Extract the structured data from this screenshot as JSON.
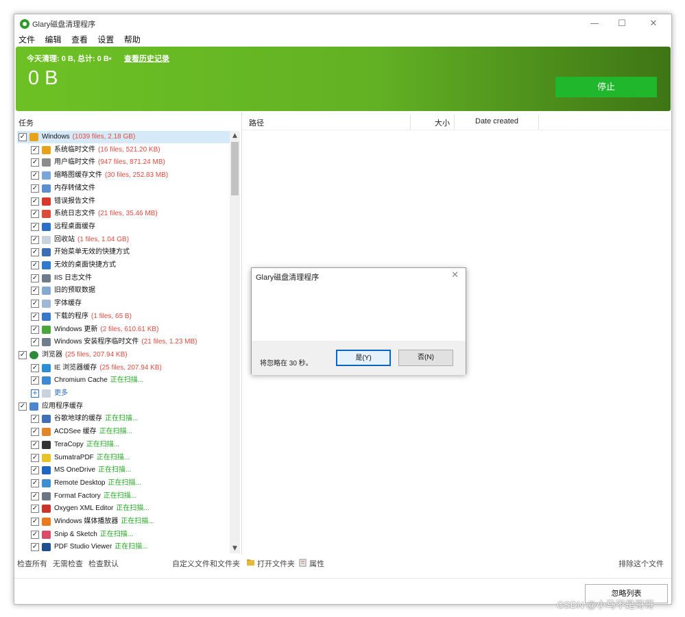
{
  "window": {
    "title": "Glary磁盘清理程序",
    "controls": {
      "minimize": "—",
      "maximize": "☐",
      "close": "✕"
    }
  },
  "menu": [
    "文件",
    "编辑",
    "查看",
    "设置",
    "帮助"
  ],
  "banner": {
    "summary": "今天清理: 0 B, 总计: 0 B•",
    "history_link": "查看历史记录",
    "total": "0 B",
    "stop_button": "停止"
  },
  "tasks_header": "任务",
  "tree": [
    {
      "level": 0,
      "label": "Windows",
      "count": "(1039 files, 2.18 GB)",
      "status": "",
      "icon": "windows-icon",
      "color": "#e7a21a",
      "selected": true
    },
    {
      "level": 1,
      "label": "系统临时文件",
      "count": "(16 files, 521.20 KB)",
      "status": "",
      "icon": "windows-temp-icon",
      "color": "#e7a21a"
    },
    {
      "level": 1,
      "label": "用户临时文件",
      "count": "(947 files, 871.24 MB)",
      "status": "",
      "icon": "user-temp-icon",
      "color": "#8c8c8c"
    },
    {
      "level": 1,
      "label": "缩略图缓存文件",
      "count": "(30 files, 252.83 MB)",
      "status": "",
      "icon": "thumbnail-icon",
      "color": "#7aa7d8"
    },
    {
      "level": 1,
      "label": "内存转储文件",
      "count": "",
      "status": "",
      "icon": "memory-dump-icon",
      "color": "#5b8fd1"
    },
    {
      "level": 1,
      "label": "错误报告文件",
      "count": "",
      "status": "",
      "icon": "error-report-icon",
      "color": "#d9392c"
    },
    {
      "level": 1,
      "label": "系统日志文件",
      "count": "(21 files, 35.46 MB)",
      "status": "",
      "icon": "system-log-icon",
      "color": "#d94c3a"
    },
    {
      "level": 1,
      "label": "远程桌面缓存",
      "count": "",
      "status": "",
      "icon": "remote-desktop-icon",
      "color": "#2a6fc9"
    },
    {
      "level": 1,
      "label": "回收站",
      "count": "(1 files, 1.04 GB)",
      "status": "",
      "icon": "recycle-bin-icon",
      "color": "#c9d3de"
    },
    {
      "level": 1,
      "label": "开始菜单无效的快捷方式",
      "count": "",
      "status": "",
      "icon": "start-menu-icon",
      "color": "#3b6eb5"
    },
    {
      "level": 1,
      "label": "无效的桌面快捷方式",
      "count": "",
      "status": "",
      "icon": "desktop-shortcut-icon",
      "color": "#2f7ad1"
    },
    {
      "level": 1,
      "label": "IIS 日志文件",
      "count": "",
      "status": "",
      "icon": "iis-log-icon",
      "color": "#6d7b8a"
    },
    {
      "level": 1,
      "label": "旧的预取数据",
      "count": "",
      "status": "",
      "icon": "prefetch-icon",
      "color": "#86a9d2"
    },
    {
      "level": 1,
      "label": "字体缓存",
      "count": "",
      "status": "",
      "icon": "font-cache-icon",
      "color": "#9fb8d6"
    },
    {
      "level": 1,
      "label": "下载的程序",
      "count": "(1 files, 65 B)",
      "status": "",
      "icon": "downloaded-program-icon",
      "color": "#3a78c9"
    },
    {
      "level": 1,
      "label": "Windows 更新",
      "count": "(2 files, 610.61 KB)",
      "status": "",
      "icon": "windows-update-icon",
      "color": "#4aa53a"
    },
    {
      "level": 1,
      "label": "Windows 安装程序临时文件",
      "count": "(21 files, 1.23 MB)",
      "status": "",
      "icon": "installer-temp-icon",
      "color": "#6f7d8c"
    },
    {
      "level": 0,
      "label": "浏览器",
      "count": "(25 files, 207.94 KB)",
      "status": "",
      "icon": "globe-icon",
      "color": "#2c8a3a"
    },
    {
      "level": 1,
      "label": "IE 浏览器缓存",
      "count": "(25 files, 207.94 KB)",
      "status": "",
      "icon": "ie-icon",
      "color": "#2b8fd8"
    },
    {
      "level": 1,
      "label": "Chromium Cache",
      "count": "",
      "status": "正在扫描...",
      "icon": "chromium-icon",
      "color": "#3c8ad6"
    },
    {
      "level": 1,
      "label": "更多",
      "count": "",
      "status": "",
      "icon": "more-icon",
      "color": "#c9d3de",
      "expander": true
    },
    {
      "level": 0,
      "label": "应用程序缓存",
      "count": "",
      "status": "",
      "icon": "app-cache-icon",
      "color": "#4c86cf"
    },
    {
      "level": 1,
      "label": "谷歌地球的缓存",
      "count": "",
      "status": "正在扫描...",
      "icon": "google-earth-icon",
      "color": "#3f6fb8"
    },
    {
      "level": 1,
      "label": "ACDSee 缓存",
      "count": "",
      "status": "正在扫描...",
      "icon": "acdsee-icon",
      "color": "#e2862a"
    },
    {
      "level": 1,
      "label": "TeraCopy",
      "count": "",
      "status": "正在扫描...",
      "icon": "teracopy-icon",
      "color": "#333333"
    },
    {
      "level": 1,
      "label": "SumatraPDF",
      "count": "",
      "status": "正在扫描...",
      "icon": "sumatrapdf-icon",
      "color": "#e8c22a"
    },
    {
      "level": 1,
      "label": "MS OneDrive",
      "count": "",
      "status": "正在扫描...",
      "icon": "onedrive-icon",
      "color": "#1f66c2"
    },
    {
      "level": 1,
      "label": "Remote Desktop",
      "count": "",
      "status": "正在扫描...",
      "icon": "remote-desktop-app-icon",
      "color": "#3b8fd2"
    },
    {
      "level": 1,
      "label": "Format Factory",
      "count": "",
      "status": "正在扫描...",
      "icon": "format-factory-icon",
      "color": "#6a7683"
    },
    {
      "level": 1,
      "label": "Oxygen XML Editor",
      "count": "",
      "status": "正在扫描...",
      "icon": "oxygen-xml-icon",
      "color": "#c9352b"
    },
    {
      "level": 1,
      "label": "Windows 媒体播放器",
      "count": "",
      "status": "正在扫描...",
      "icon": "media-player-icon",
      "color": "#e97b1e"
    },
    {
      "level": 1,
      "label": "Snip & Sketch",
      "count": "",
      "status": "正在扫描...",
      "icon": "snip-sketch-icon",
      "color": "#d94c6a"
    },
    {
      "level": 1,
      "label": "PDF Studio Viewer",
      "count": "",
      "status": "正在扫描...",
      "icon": "pdf-studio-icon",
      "color": "#1f4f8f"
    }
  ],
  "columns": {
    "path": "路径",
    "size": "大小",
    "date": "Date created"
  },
  "bottom_bar": {
    "check_all": "检查所有",
    "check_none": "无需检查",
    "check_default": "检查默认",
    "custom": "自定义文件和文件夹",
    "open_folder": "打开文件夹",
    "properties": "属性",
    "exclude": "排除这个文件"
  },
  "ignore_list_button": "忽略列表",
  "dialog": {
    "title": "Glary磁盘清理程序",
    "message": "将忽略在 30 秒。",
    "yes": "是(Y)",
    "no": "否(N)",
    "close": "✕"
  },
  "watermark": "CSDN @小马不是哥哥"
}
